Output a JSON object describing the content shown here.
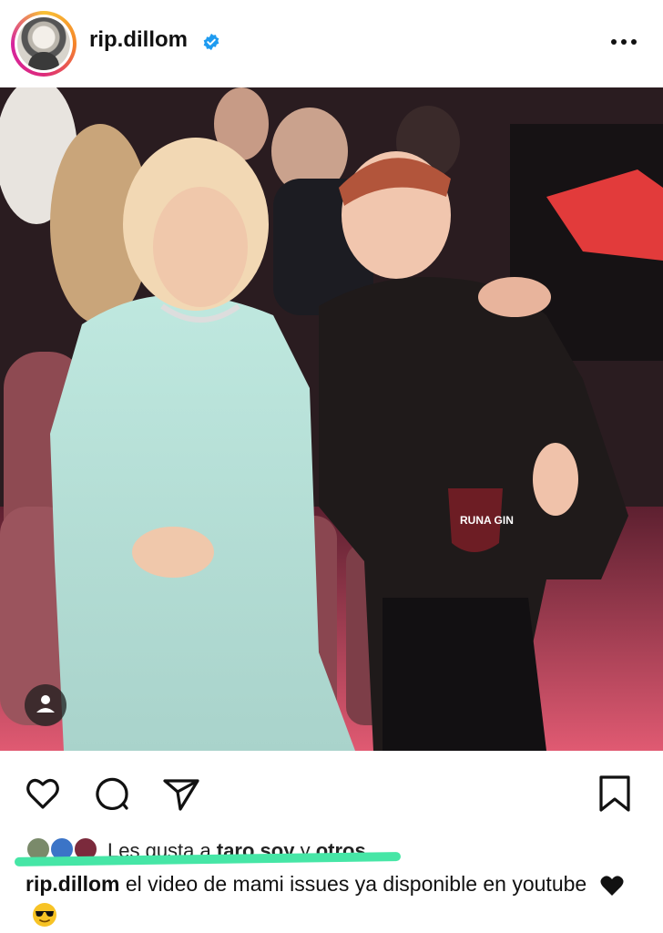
{
  "post": {
    "username": "rip.dillom",
    "photo_label": "RUNA GIN",
    "likes": {
      "prefix": "Les gusta a",
      "user": "taro.soy",
      "connector": "y",
      "others": "otros"
    },
    "caption": {
      "username": "rip.dillom",
      "text": "el video de mami issues ya disponible en youtube"
    }
  },
  "colors": {
    "verified": "#1e9bf0",
    "highlight": "#46e6a6",
    "story_ring": "#dd2a7b"
  },
  "icons": {
    "verified": "verified-badge-icon",
    "more": "more-options-icon",
    "like": "heart-icon",
    "comment": "comment-icon",
    "share": "send-icon",
    "save": "bookmark-icon",
    "tag": "person-tag-icon"
  }
}
